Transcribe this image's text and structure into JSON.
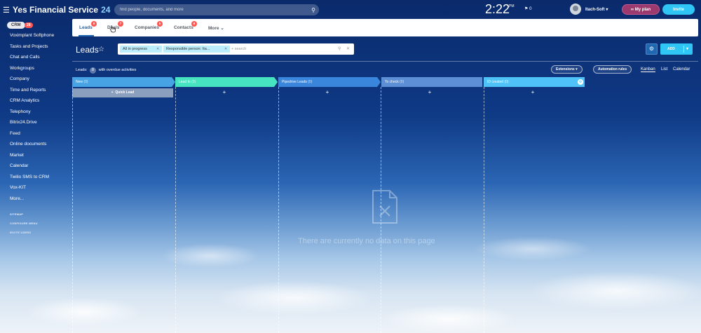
{
  "app": {
    "title": "Yes Financial Service",
    "title_suffix": "24",
    "search_placeholder": "find people, documents, and more",
    "clock": "2:22",
    "clock_ampm": "PM",
    "flag_count": "0",
    "user_name": "Itach-Soft",
    "my_plan_label": "My plan",
    "invite_label": "Invite"
  },
  "sidebar": {
    "crm_label": "CRM",
    "crm_count": "28",
    "items": [
      {
        "label": "Voximplant Softphone"
      },
      {
        "label": "Tasks and Projects"
      },
      {
        "label": "Chat and Calls"
      },
      {
        "label": "Workgroups"
      },
      {
        "label": "Company"
      },
      {
        "label": "Time and Reports"
      },
      {
        "label": "CRM Analytics"
      },
      {
        "label": "Telephony"
      },
      {
        "label": "Bitrix24.Drive"
      },
      {
        "label": "Feed"
      },
      {
        "label": "Online documents"
      },
      {
        "label": "Market"
      },
      {
        "label": "Calendar"
      },
      {
        "label": "Twilio SMS to CRM"
      },
      {
        "label": "Vox-KIT"
      },
      {
        "label": "More..."
      }
    ],
    "footer": [
      {
        "label": "SITEMAP"
      },
      {
        "label": "CONFIGURE MENU"
      },
      {
        "label": "INVITE USERS"
      }
    ]
  },
  "tabs": [
    {
      "label": "Leads",
      "badge": "8"
    },
    {
      "label": "Deals",
      "badge": "7"
    },
    {
      "label": "Companies",
      "badge": "5"
    },
    {
      "label": "Contacts",
      "badge": "6"
    },
    {
      "label": "More"
    }
  ],
  "page": {
    "title": "Leads",
    "filters": [
      {
        "label": "All in progress"
      },
      {
        "label": "Responsible person: Ita..."
      }
    ],
    "search_placeholder": "+ search",
    "add_label": "ADD",
    "overdue_prefix": "Leads:",
    "overdue_count": "8",
    "overdue_suffix": "with overdue activities",
    "extensions_label": "Extensions",
    "automation_label": "Automation rules",
    "views": [
      {
        "label": "Kanban"
      },
      {
        "label": "List"
      },
      {
        "label": "Calendar"
      }
    ]
  },
  "kanban": {
    "quick_lead_label": "Quick Lead",
    "columns": [
      {
        "name": "New",
        "count": "(0)",
        "color": "#47a3e4"
      },
      {
        "name": "Lead In",
        "count": "(0)",
        "color": "#47e4c2"
      },
      {
        "name": "Pipedrive Leads",
        "count": "(0)",
        "color": "#3a86dd"
      },
      {
        "name": "To check",
        "count": "(0)",
        "color": "#5c8fd6"
      },
      {
        "name": "ID created",
        "count": "(0)",
        "color": "#4fc3f7"
      }
    ],
    "empty_text": "There are currently no data on this page"
  },
  "colors": {
    "accent": "#2fc6f6",
    "tab_active": "#2067b0",
    "badge": "#ff5752",
    "my_plan": "#9b3a6e"
  }
}
